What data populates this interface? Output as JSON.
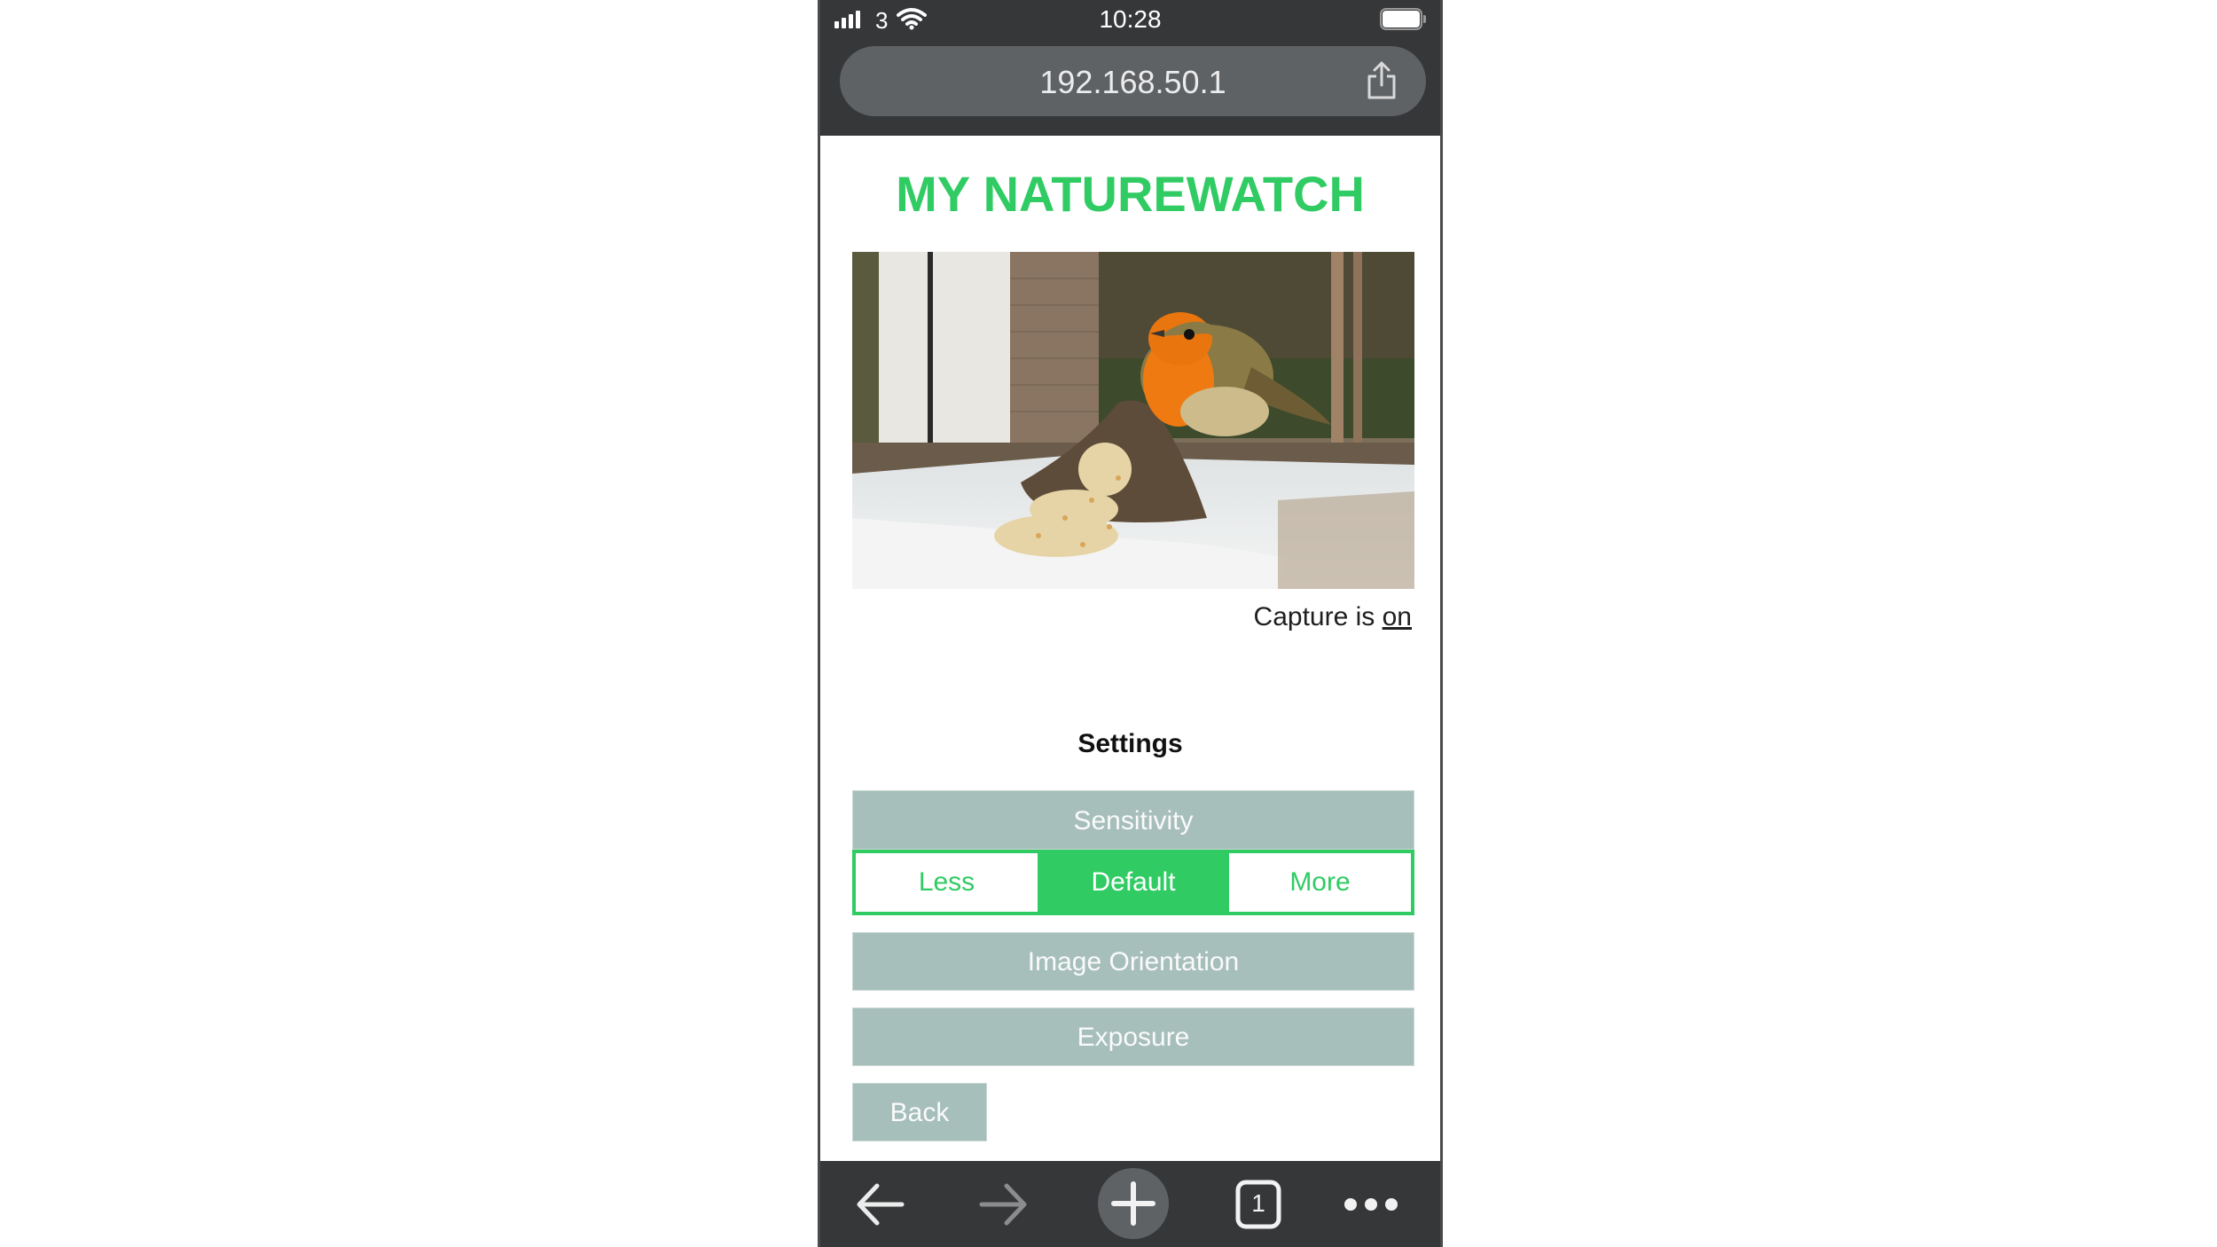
{
  "status_bar": {
    "carrier": "3",
    "time": "10:28",
    "signal_icon": "cellular-signal-icon",
    "wifi_icon": "wifi-icon",
    "battery_icon": "battery-full-icon"
  },
  "browser": {
    "url": "192.168.50.1",
    "share_icon": "share-icon",
    "toolbar": {
      "back_icon": "arrow-left-icon",
      "forward_icon": "arrow-right-icon",
      "new_tab_icon": "plus-icon",
      "tab_count": "1",
      "more_icon": "more-horizontal-icon"
    }
  },
  "page": {
    "title": "MY NATUREWATCH",
    "camera_feed_alt": "Live camera view of a robin perched on a log in a seed tray",
    "capture": {
      "prefix": "Capture is",
      "state_link": "on"
    },
    "settings": {
      "heading": "Settings",
      "sensitivity": {
        "label": "Sensitivity",
        "options": [
          "Less",
          "Default",
          "More"
        ],
        "selected": "Default"
      },
      "image_orientation_label": "Image Orientation",
      "exposure_label": "Exposure",
      "back_label": "Back"
    }
  },
  "colors": {
    "accent_green": "#30cb63",
    "panel_grey": "#a7bfbb",
    "chrome_dark": "#363739"
  }
}
